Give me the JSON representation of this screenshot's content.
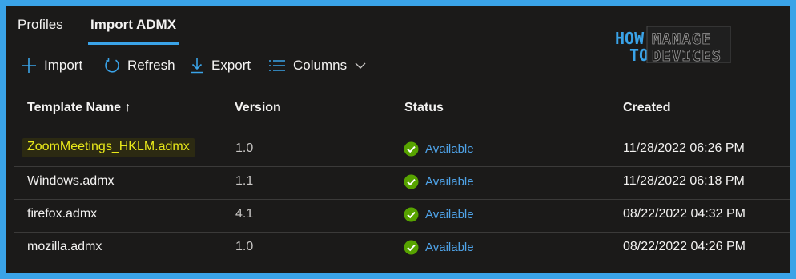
{
  "tabs": [
    {
      "label": "Profiles"
    },
    {
      "label": "Import ADMX"
    }
  ],
  "toolbar": {
    "import_label": "Import",
    "refresh_label": "Refresh",
    "export_label": "Export",
    "columns_label": "Columns"
  },
  "logo": {
    "how": "HOW",
    "to": "TO",
    "manage": "MANAGE",
    "devices": "DEVICES"
  },
  "table": {
    "headers": {
      "name": "Template Name ↑",
      "version": "Version",
      "status": "Status",
      "created": "Created"
    },
    "rows": [
      {
        "name": "ZoomMeetings_HKLM.admx",
        "version": "1.0",
        "status": "Available",
        "created": "11/28/2022 06:26 PM"
      },
      {
        "name": "Windows.admx",
        "version": "1.1",
        "status": "Available",
        "created": "11/28/2022 06:18 PM"
      },
      {
        "name": "firefox.admx",
        "version": "4.1",
        "status": "Available",
        "created": "08/22/2022 04:32 PM"
      },
      {
        "name": "mozilla.admx",
        "version": "1.0",
        "status": "Available",
        "created": "08/22/2022 04:26 PM"
      }
    ]
  },
  "colors": {
    "accent": "#3aa3e8",
    "status_ok": "#57a300",
    "highlight_text": "#e8e81a"
  }
}
